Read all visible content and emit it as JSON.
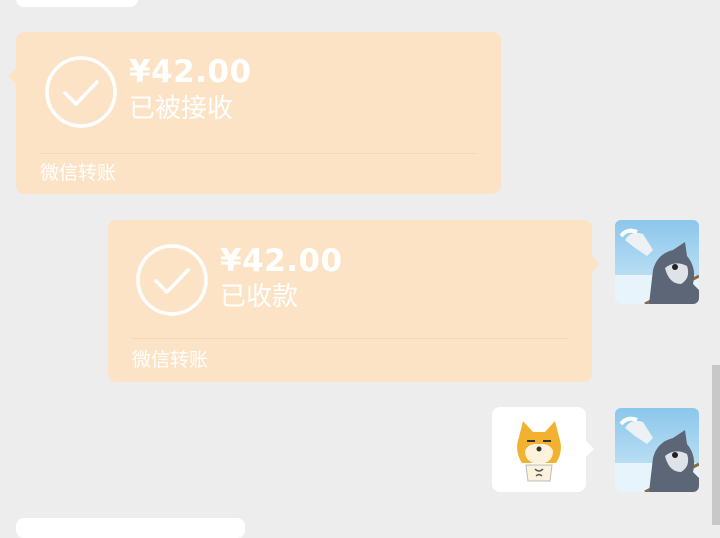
{
  "messages": [
    {
      "side": "left",
      "amount": "¥42.00",
      "status": "已被接收",
      "footer": "微信转账"
    },
    {
      "side": "right",
      "amount": "¥42.00",
      "status": "已收款",
      "footer": "微信转账"
    }
  ],
  "sticker": {
    "icon": "shiba-doge-sticker-icon"
  },
  "avatar": {
    "icon": "tom-cat-avatar-icon"
  },
  "colors": {
    "background": "#ededed",
    "transfer_bubble": "#fde3c5",
    "white_bubble": "#ffffff"
  }
}
